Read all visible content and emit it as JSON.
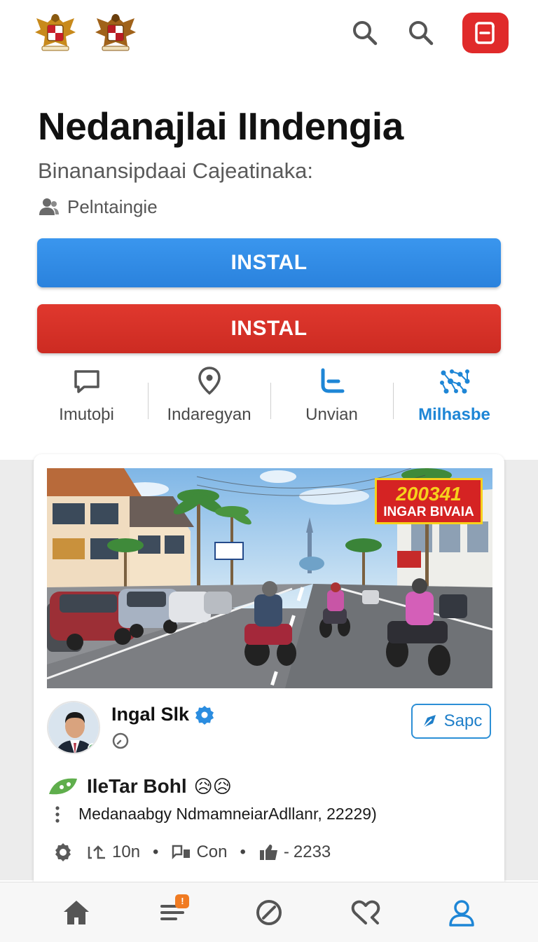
{
  "header": {
    "emblems": [
      "garuda-emblem",
      "garuda-emblem"
    ],
    "icons": [
      "search-icon",
      "search-icon",
      "exit-icon"
    ]
  },
  "app": {
    "title": "Nedanajlai IIndengia",
    "subtitle": "Binanansipdaai Cajeatinaka:",
    "publisher": "Pelntaingie"
  },
  "buttons": {
    "install_primary": "INSTAL",
    "install_secondary": "INSTAL"
  },
  "actions": [
    {
      "label": "Imutoþi",
      "icon": "chat-icon"
    },
    {
      "label": "Indaregyan",
      "icon": "location-pin-icon"
    },
    {
      "label": "Unvian",
      "icon": "l-shape-icon"
    },
    {
      "label": "Milhasbe",
      "icon": "network-icon",
      "active": true
    }
  ],
  "post": {
    "banner_line1": "200341",
    "banner_line2": "INGAR BIVAIA",
    "author": "Ingal Slk",
    "verified": true,
    "follow_label": "Sapc",
    "title": "IleTar Bohl",
    "title_emojis": "😥😥",
    "description": "Medanaabgy NdmamneiarAdllanr, 22229)",
    "stats": {
      "reposts": "10n",
      "comments": "Con",
      "likes": "2233"
    }
  },
  "bottom_nav": {
    "items": [
      "home-icon",
      "menu-icon",
      "explore-icon",
      "heart-icon",
      "profile-icon"
    ],
    "notification_badge": "!",
    "active": "profile-icon"
  },
  "colors": {
    "install_blue": "#2a82dd",
    "install_red": "#cc2b22",
    "accent": "#1e86d6",
    "exit_button": "#e02a2a",
    "badge": "#f07b22"
  }
}
